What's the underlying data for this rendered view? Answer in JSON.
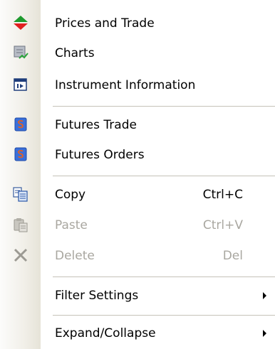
{
  "menu": {
    "items": [
      {
        "label": "Prices and Trade",
        "shortcut": "",
        "icon": "prices-trade-icon",
        "enabled": true
      },
      {
        "label": "Charts",
        "shortcut": "",
        "icon": "chart-icon",
        "enabled": true
      },
      {
        "label": "Instrument Information",
        "shortcut": "",
        "icon": "instrument-info-icon",
        "enabled": true
      },
      {
        "label": "Futures Trade",
        "shortcut": "",
        "icon": "futures-icon",
        "enabled": true
      },
      {
        "label": "Futures Orders",
        "shortcut": "",
        "icon": "futures-icon",
        "enabled": true
      },
      {
        "label": "Copy",
        "shortcut": "Ctrl+C",
        "icon": "copy-icon",
        "enabled": true
      },
      {
        "label": "Paste",
        "shortcut": "Ctrl+V",
        "icon": "paste-icon",
        "enabled": false
      },
      {
        "label": "Delete",
        "shortcut": "Del",
        "icon": "delete-icon",
        "enabled": false
      },
      {
        "label": "Filter Settings",
        "shortcut": "",
        "icon": "",
        "enabled": true,
        "submenu": true
      },
      {
        "label": "Expand/Collapse",
        "shortcut": "",
        "icon": "",
        "enabled": true,
        "submenu": true
      }
    ]
  },
  "colors": {
    "text": "#000000",
    "disabled_text": "#a9a7a0",
    "separator": "#c5c2b8",
    "up_arrow": "#1e9a2e",
    "down_arrow": "#e02020",
    "futures_badge": "#3a6fd8"
  }
}
